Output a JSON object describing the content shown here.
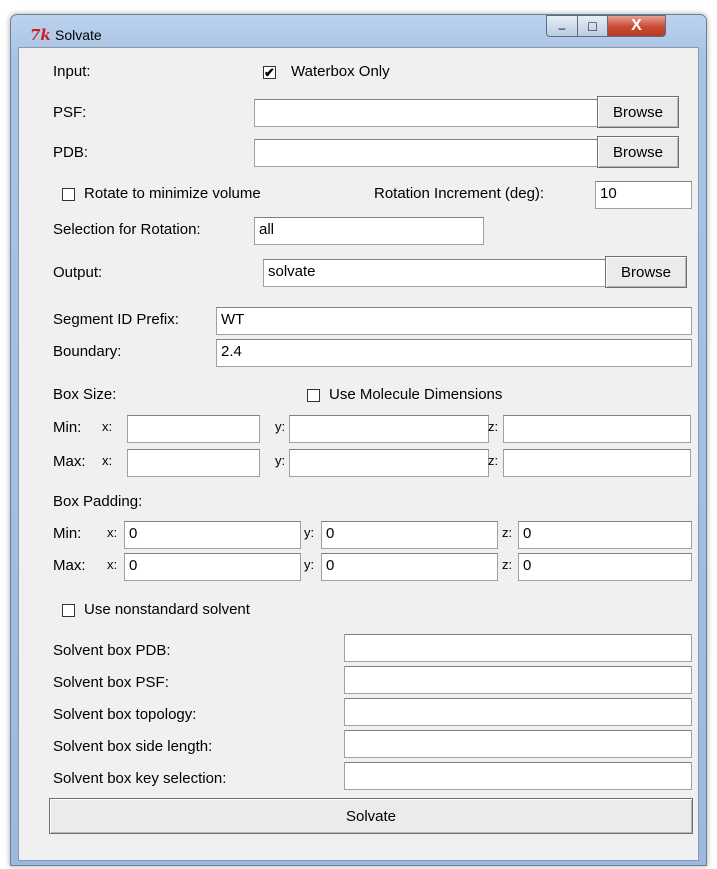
{
  "window": {
    "title": "Solvate",
    "icon_glyph": "7k",
    "minimize_glyph": "–",
    "maximize_glyph": "□",
    "close_glyph": "X"
  },
  "input": {
    "label": "Input:",
    "waterbox_only": {
      "label": "Waterbox Only",
      "checked": true
    },
    "psf_label": "PSF:",
    "psf_value": "",
    "pdb_label": "PDB:",
    "pdb_value": "",
    "browse": "Browse"
  },
  "rotation": {
    "rotate_label": "Rotate to minimize volume",
    "rotate_checked": false,
    "increment_label": "Rotation Increment (deg):",
    "increment_value": "10",
    "selection_label": "Selection for Rotation:",
    "selection_value": "all"
  },
  "output": {
    "label": "Output:",
    "value": "solvate",
    "browse": "Browse"
  },
  "segment": {
    "label": "Segment ID Prefix:",
    "value": "WT"
  },
  "boundary": {
    "label": "Boundary:",
    "value": "2.4"
  },
  "box_size": {
    "label": "Box Size:",
    "use_molecule_dimensions": {
      "label": "Use Molecule Dimensions",
      "checked": false
    },
    "min_label": "Min:",
    "max_label": "Max:",
    "x_label": "x:",
    "y_label": "y:",
    "z_label": "z:",
    "min": {
      "x": "",
      "y": "",
      "z": ""
    },
    "max": {
      "x": "",
      "y": "",
      "z": ""
    }
  },
  "box_padding": {
    "label": "Box Padding:",
    "min_label": "Min:",
    "max_label": "Max:",
    "x_label": "x:",
    "y_label": "y:",
    "z_label": "z:",
    "min": {
      "x": "0",
      "y": "0",
      "z": "0"
    },
    "max": {
      "x": "0",
      "y": "0",
      "z": "0"
    }
  },
  "solvent": {
    "nonstandard": {
      "label": "Use nonstandard solvent",
      "checked": false
    },
    "pdb_label": "Solvent box PDB:",
    "pdb_value": "",
    "psf_label": "Solvent box PSF:",
    "psf_value": "",
    "topology_label": "Solvent box topology:",
    "topology_value": "",
    "side_length_label": "Solvent box side length:",
    "side_length_value": "",
    "key_selection_label": "Solvent box key selection:",
    "key_selection_value": ""
  },
  "solvate_button": "Solvate"
}
